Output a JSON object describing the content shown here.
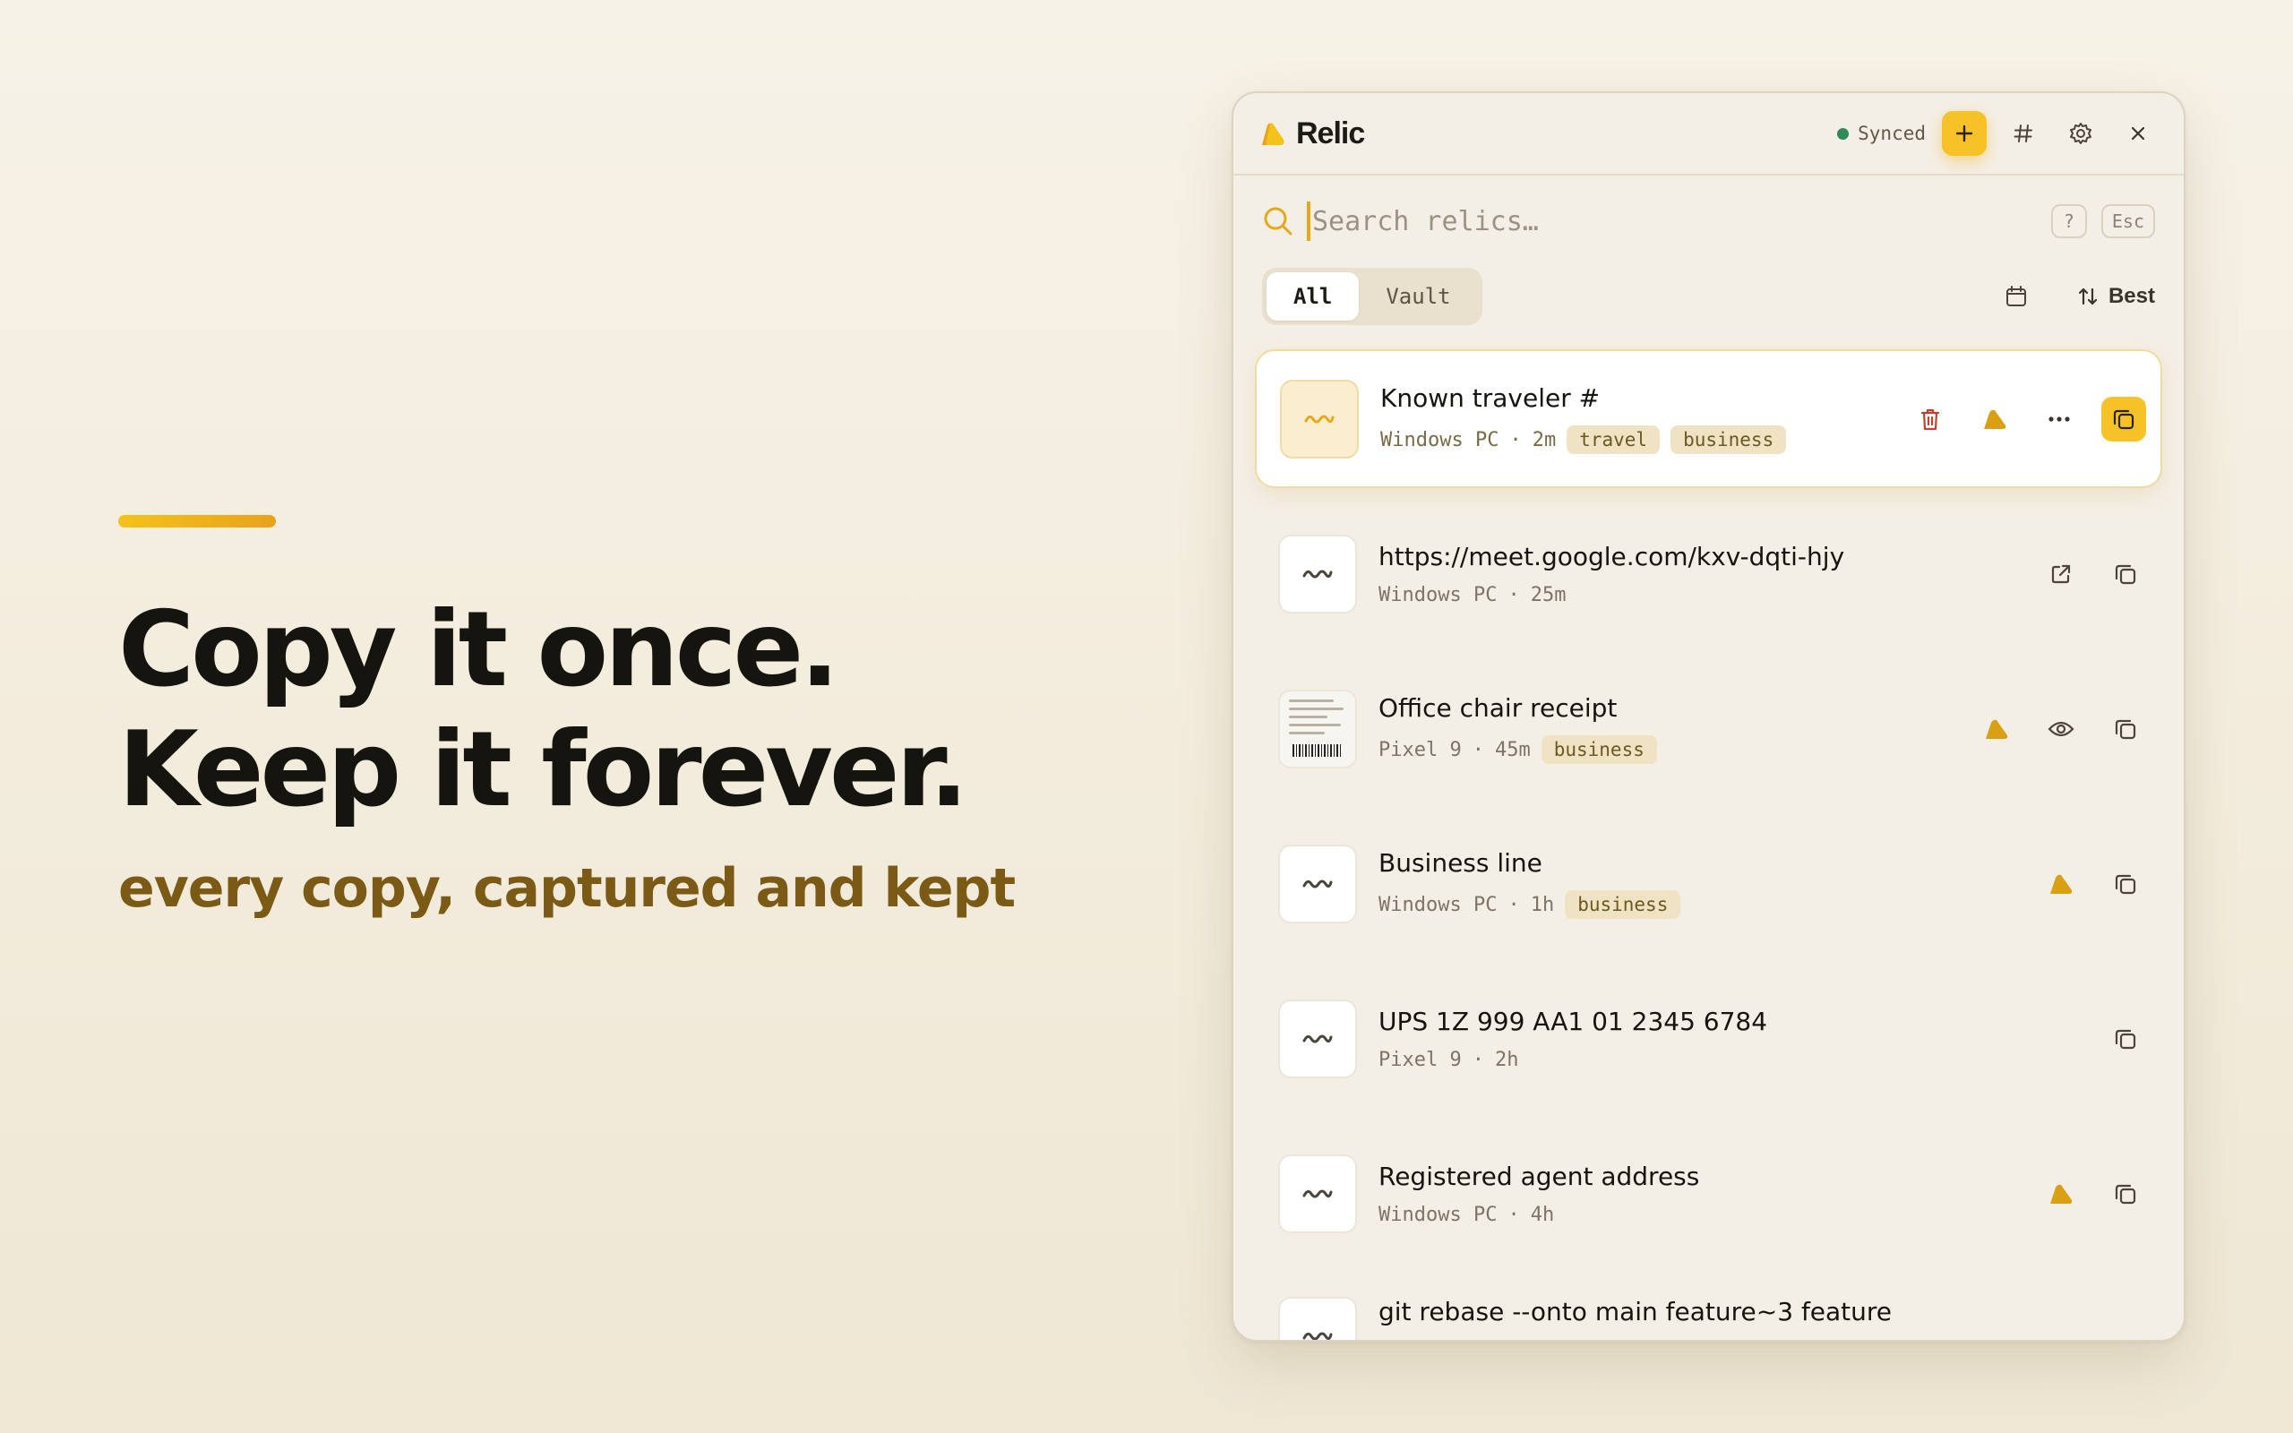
{
  "hero": {
    "headline_line1": "Copy it once.",
    "headline_line2": "Keep it forever.",
    "subline": "every copy, captured and kept"
  },
  "window": {
    "app_name": "Relic",
    "sync_status": "Synced",
    "accent_color": "#f6c227",
    "icons": [
      "add-icon",
      "hash-icon",
      "gear-icon",
      "close-icon"
    ]
  },
  "search": {
    "placeholder": "Search relics…",
    "help_key": "?",
    "esc_key": "Esc"
  },
  "filters": {
    "tabs": [
      {
        "label": "All",
        "active": true
      },
      {
        "label": "Vault",
        "active": false
      }
    ],
    "sort_label": "Best"
  },
  "items": [
    {
      "title": "Known traveler #",
      "device": "Windows PC",
      "age": "2m",
      "tags": [
        "travel",
        "business"
      ],
      "selected": true
    },
    {
      "title": "https://meet.google.com/kxv-dqti-hjy",
      "device": "Windows PC",
      "age": "25m",
      "tags": []
    },
    {
      "title": "Office chair receipt",
      "device": "Pixel 9",
      "age": "45m",
      "tags": [
        "business"
      ]
    },
    {
      "title": "Business line",
      "device": "Windows PC",
      "age": "1h",
      "tags": [
        "business"
      ]
    },
    {
      "title": "UPS 1Z 999 AA1 01 2345 6784",
      "device": "Pixel 9",
      "age": "2h",
      "tags": []
    },
    {
      "title": "Registered agent address",
      "device": "Windows PC",
      "age": "4h",
      "tags": []
    },
    {
      "title": "git rebase --onto main feature~3 feature"
    }
  ],
  "separator": "·"
}
